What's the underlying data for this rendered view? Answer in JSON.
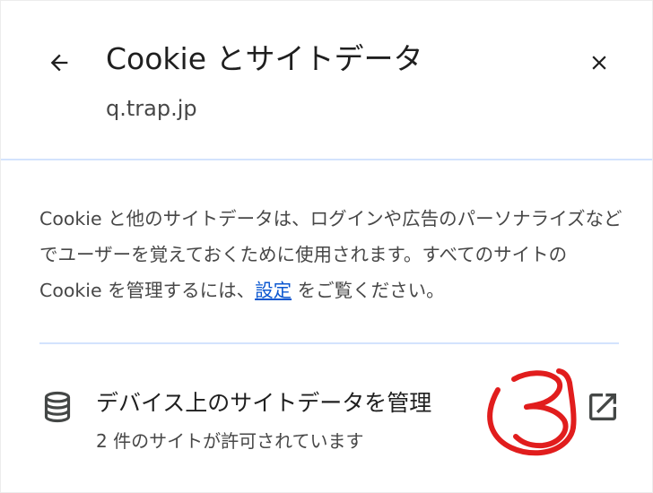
{
  "header": {
    "title": "Cookie とサイトデータ",
    "site": "q.trap.jp"
  },
  "description": {
    "text_before_link": "Cookie と他のサイトデータは、ログインや広告のパーソナライズなどでユーザーを覚えておくために使用されます。すべてのサイトの Cookie を管理するには、",
    "link_label": "設定",
    "text_after_link": " をご覧ください。"
  },
  "manage_row": {
    "title": "デバイス上のサイトデータを管理",
    "subtitle": "2 件のサイトが許可されています",
    "icon": "database-icon",
    "action_icon": "open-in-new-icon"
  },
  "annotation": {
    "text": "3",
    "color": "#e11d1d"
  },
  "colors": {
    "divider": "#d3e3fd",
    "link": "#0b57d0",
    "text_primary": "#1f1f1f",
    "text_secondary": "#474747"
  }
}
